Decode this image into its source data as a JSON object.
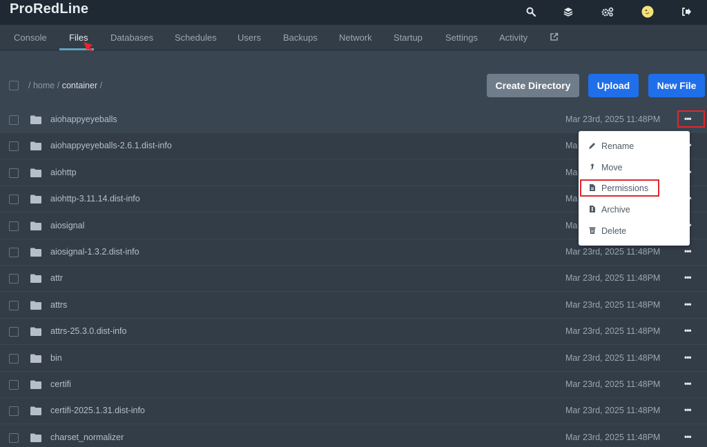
{
  "app": {
    "brand": "ProRedLine"
  },
  "topbar": {
    "icons": [
      "search-icon",
      "layers-icon",
      "cogs-icon",
      "avatar",
      "logout-icon"
    ]
  },
  "nav": {
    "items": [
      {
        "label": "Console",
        "active": false
      },
      {
        "label": "Files",
        "active": true
      },
      {
        "label": "Databases",
        "active": false
      },
      {
        "label": "Schedules",
        "active": false
      },
      {
        "label": "Users",
        "active": false
      },
      {
        "label": "Backups",
        "active": false
      },
      {
        "label": "Network",
        "active": false
      },
      {
        "label": "Startup",
        "active": false
      },
      {
        "label": "Settings",
        "active": false
      },
      {
        "label": "Activity",
        "active": false
      }
    ],
    "external_icon": "external-link-icon"
  },
  "breadcrumb": {
    "sep1": "/",
    "home": "home",
    "sep2": "/",
    "current": "container",
    "sep3": "/"
  },
  "toolbar": {
    "create_directory": "Create Directory",
    "upload": "Upload",
    "new_file": "New File"
  },
  "colors": {
    "accent_blue": "#1f6feb",
    "highlight_red": "#e3262e",
    "tab_underline": "#5fa5bd"
  },
  "files": [
    {
      "name": "aiohappyeyeballs",
      "date": "Mar 23rd, 2025 11:48PM"
    },
    {
      "name": "aiohappyeyeballs-2.6.1.dist-info",
      "date": "Ma"
    },
    {
      "name": "aiohttp",
      "date": "Ma"
    },
    {
      "name": "aiohttp-3.11.14.dist-info",
      "date": "Ma"
    },
    {
      "name": "aiosignal",
      "date": "Ma"
    },
    {
      "name": "aiosignal-1.3.2.dist-info",
      "date": "Mar 23rd, 2025 11:48PM"
    },
    {
      "name": "attr",
      "date": "Mar 23rd, 2025 11:48PM"
    },
    {
      "name": "attrs",
      "date": "Mar 23rd, 2025 11:48PM"
    },
    {
      "name": "attrs-25.3.0.dist-info",
      "date": "Mar 23rd, 2025 11:48PM"
    },
    {
      "name": "bin",
      "date": "Mar 23rd, 2025 11:48PM"
    },
    {
      "name": "certifi",
      "date": "Mar 23rd, 2025 11:48PM"
    },
    {
      "name": "certifi-2025.1.31.dist-info",
      "date": "Mar 23rd, 2025 11:48PM"
    },
    {
      "name": "charset_normalizer",
      "date": "Mar 23rd, 2025 11:48PM"
    }
  ],
  "row_menu_label": "•••",
  "context_menu": {
    "items": [
      {
        "label": "Rename",
        "icon": "pencil-icon"
      },
      {
        "label": "Move",
        "icon": "move-arrow-icon"
      },
      {
        "label": "Permissions",
        "icon": "file-icon"
      },
      {
        "label": "Archive",
        "icon": "archive-icon"
      },
      {
        "label": "Delete",
        "icon": "trash-icon"
      }
    ]
  }
}
